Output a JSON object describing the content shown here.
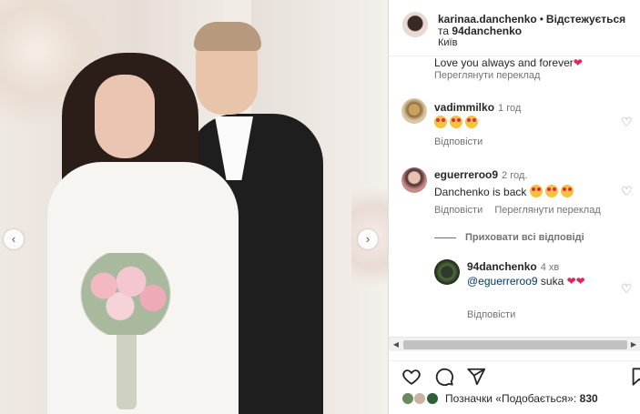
{
  "photo": {
    "prev_button": "‹",
    "next_button": "›"
  },
  "header": {
    "author": "karinaa.danchenko",
    "dot": "•",
    "follow_label": "Відстежується",
    "conjunction": "та",
    "coauthor": "94danchenko",
    "location": "Київ"
  },
  "comments": {
    "caption_tail": "Love you always and forever",
    "caption_translate": "Переглянути переклад",
    "items": [
      {
        "user": "vadimmilko",
        "time": "1 год",
        "reply": "Відповісти"
      },
      {
        "user": "eguerreroo9",
        "time": "2 год.",
        "text": "Danchenko is back",
        "reply": "Відповісти",
        "translate": "Переглянути переклад"
      }
    ],
    "hide_replies": "Приховати всі відповіді",
    "reply": {
      "user": "94danchenko",
      "time": "4 хв",
      "mention": "@eguerreroo9",
      "text": "suka",
      "reply_label": "Відповісти"
    }
  },
  "scrollbar": {
    "left_arrow": "◀",
    "right_arrow": "▶"
  },
  "actions": {
    "like_icon": "heart-icon",
    "comment_icon": "comment-icon",
    "share_icon": "share-icon",
    "save_icon": "bookmark-icon"
  },
  "likes": {
    "label": "Позначки «Подобається»:",
    "count": "830"
  }
}
